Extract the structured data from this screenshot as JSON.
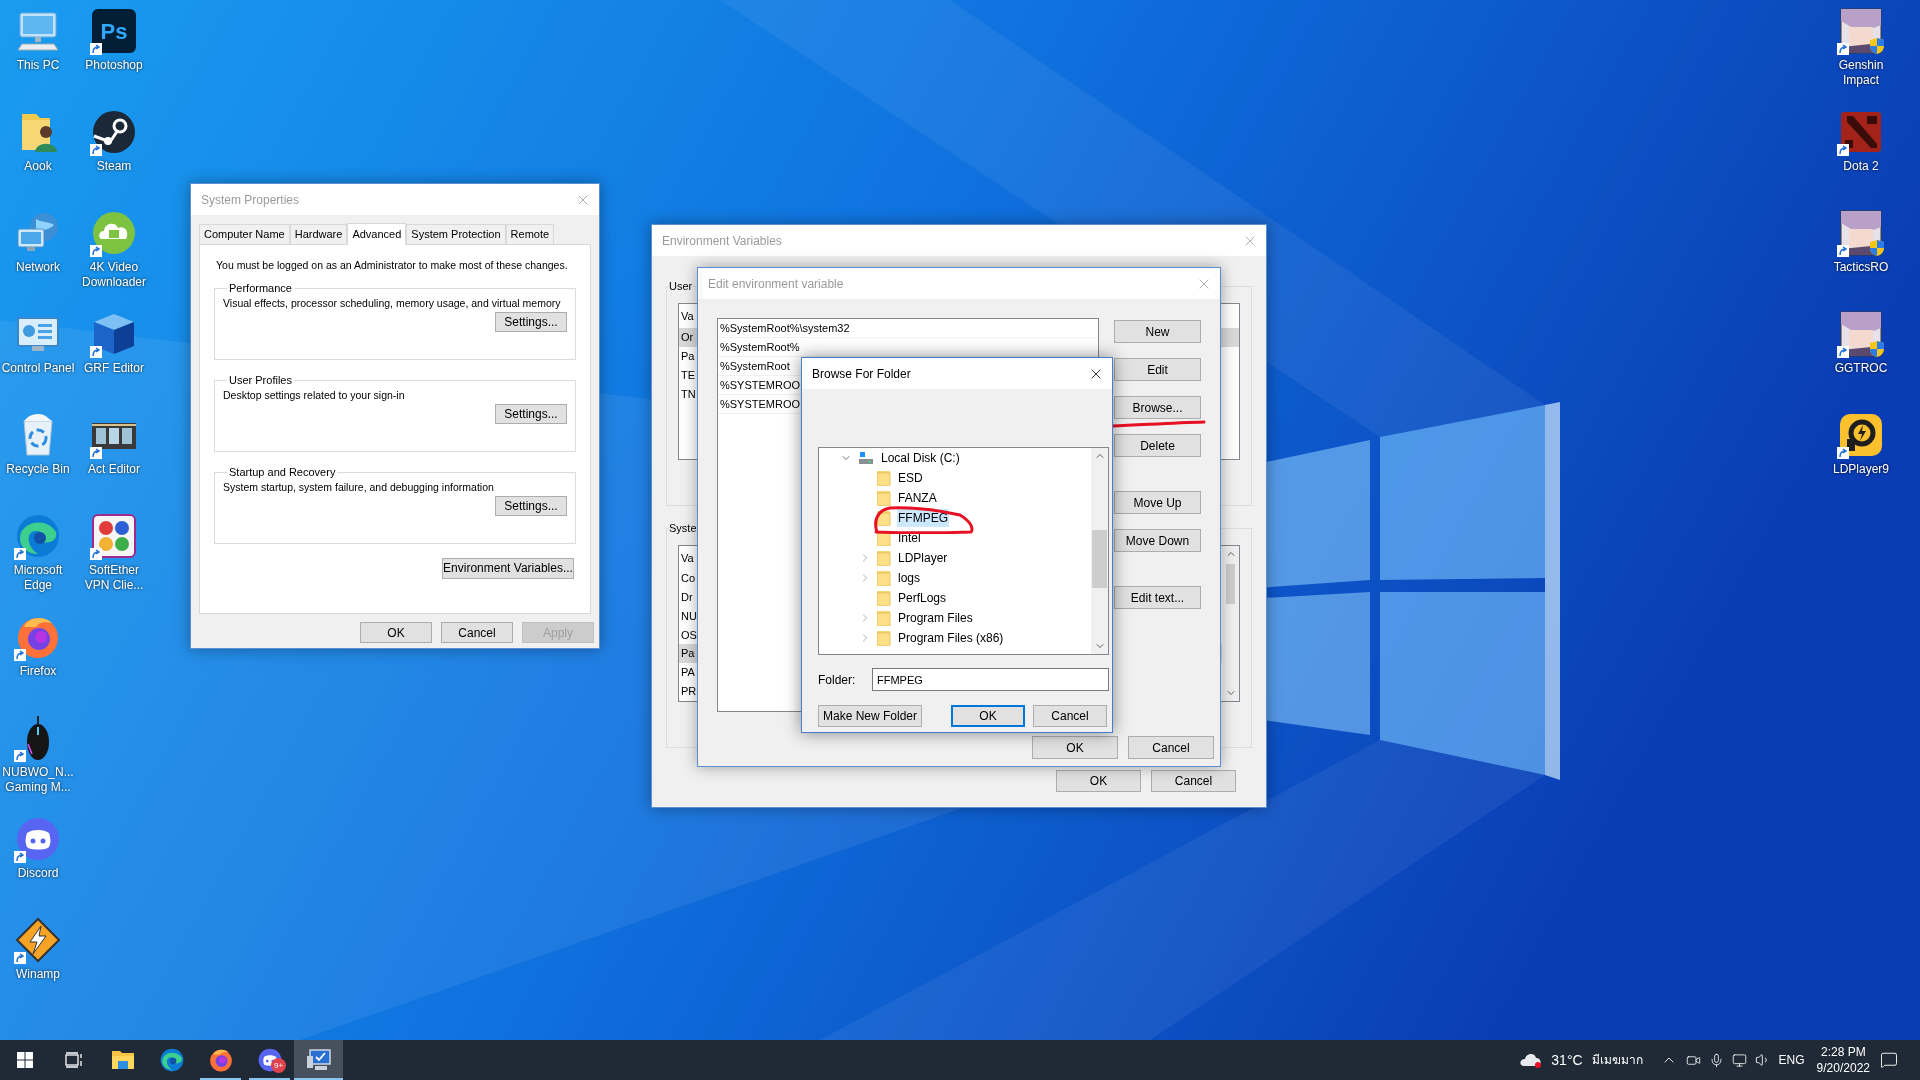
{
  "desktop_icons": {
    "left_column": [
      {
        "kind": "computer",
        "label": [
          "This PC"
        ],
        "shortcut": false,
        "admin": false
      },
      {
        "kind": "user-folder",
        "label": [
          "Aook"
        ],
        "shortcut": false,
        "admin": false
      },
      {
        "kind": "network",
        "label": [
          "Network"
        ],
        "shortcut": false,
        "admin": false
      },
      {
        "kind": "control-panel",
        "label": [
          "Control Panel"
        ],
        "shortcut": false,
        "admin": false
      },
      {
        "kind": "recycle-bin",
        "label": [
          "Recycle Bin"
        ],
        "shortcut": false,
        "admin": false
      },
      {
        "kind": "edge",
        "label": [
          "Microsoft",
          "Edge"
        ],
        "shortcut": true,
        "admin": false
      },
      {
        "kind": "firefox",
        "label": [
          "Firefox"
        ],
        "shortcut": true,
        "admin": false
      },
      {
        "kind": "mouse",
        "label": [
          "NUBWO_N...",
          "Gaming M..."
        ],
        "shortcut": true,
        "admin": false
      },
      {
        "kind": "discord",
        "label": [
          "Discord"
        ],
        "shortcut": true,
        "admin": false
      },
      {
        "kind": "winamp",
        "label": [
          "Winamp"
        ],
        "shortcut": true,
        "admin": false
      }
    ],
    "second_column": [
      {
        "kind": "photoshop",
        "glyph": "Ps",
        "label": [
          "Photoshop"
        ],
        "shortcut": true,
        "admin": false
      },
      {
        "kind": "steam",
        "label": [
          "Steam"
        ],
        "shortcut": true,
        "admin": false
      },
      {
        "kind": "cloud-download",
        "label": [
          "4K Video",
          "Downloader"
        ],
        "shortcut": true,
        "admin": false
      },
      {
        "kind": "cube",
        "label": [
          "GRF Editor"
        ],
        "shortcut": true,
        "admin": false
      },
      {
        "kind": "film",
        "label": [
          "Act Editor"
        ],
        "shortcut": true,
        "admin": false
      },
      {
        "kind": "grid",
        "label": [
          "SoftEther",
          "VPN Clie..."
        ],
        "shortcut": true,
        "admin": false
      }
    ],
    "right_column": [
      {
        "kind": "portrait",
        "label": [
          "Genshin",
          "Impact"
        ],
        "shortcut": true,
        "admin": true
      },
      {
        "kind": "dota",
        "label": [
          "Dota 2"
        ],
        "shortcut": true,
        "admin": false
      },
      {
        "kind": "portrait",
        "label": [
          "TacticsRO"
        ],
        "shortcut": true,
        "admin": true
      },
      {
        "kind": "portrait",
        "label": [
          "GGTROC"
        ],
        "shortcut": true,
        "admin": true
      },
      {
        "kind": "player",
        "label": [
          "LDPlayer9"
        ],
        "shortcut": true,
        "admin": false
      }
    ]
  },
  "system_properties": {
    "title": "System Properties",
    "active": false,
    "tabs": [
      {
        "label": "Computer Name",
        "selected": false
      },
      {
        "label": "Hardware",
        "selected": false
      },
      {
        "label": "Advanced",
        "selected": true
      },
      {
        "label": "System Protection",
        "selected": false
      },
      {
        "label": "Remote",
        "selected": false
      }
    ],
    "note": "You must be logged on as an Administrator to make most of these changes.",
    "groups": [
      {
        "title": "Performance",
        "description": "Visual effects, processor scheduling, memory usage, and virtual memory",
        "button": "Settings..."
      },
      {
        "title": "User Profiles",
        "description": "Desktop settings related to your sign-in",
        "button": "Settings..."
      },
      {
        "title": "Startup and Recovery",
        "description": "System startup, system failure, and debugging information",
        "button": "Settings..."
      }
    ],
    "env_button": "Environment Variables...",
    "buttons": [
      {
        "label": "OK",
        "disabled": false
      },
      {
        "label": "Cancel",
        "disabled": false
      },
      {
        "label": "Apply",
        "disabled": true
      }
    ]
  },
  "environment_variables": {
    "title": "Environment Variables",
    "active": false,
    "user_group": {
      "label": "User",
      "header": "Va",
      "rows": [
        {
          "text": "Or",
          "selected": true
        },
        {
          "text": "Pa",
          "selected": false
        },
        {
          "text": "TE",
          "selected": false
        },
        {
          "text": "TN",
          "selected": false
        }
      ]
    },
    "system_group": {
      "label": "Syste",
      "header": "Va",
      "rows": [
        {
          "text": "Co",
          "selected": false
        },
        {
          "text": "Dr",
          "selected": false
        },
        {
          "text": "NU",
          "selected": false
        },
        {
          "text": "OS",
          "selected": false
        },
        {
          "text": "Pa",
          "selected": true
        },
        {
          "text": "PA",
          "selected": false
        },
        {
          "text": "PR",
          "selected": false
        }
      ]
    },
    "buttons": [
      "OK",
      "Cancel"
    ]
  },
  "edit_variable": {
    "title": "Edit environment variable",
    "active": false,
    "entries": [
      "%SystemRoot%\\system32",
      "%SystemRoot%",
      "%SystemRoot",
      "%SYSTEMROO",
      "%SYSTEMROO"
    ],
    "side_button_groups": [
      [
        {
          "label": "New",
          "underlined": false
        },
        {
          "label": "Edit",
          "underlined": false
        },
        {
          "label": "Browse...",
          "underlined": true
        },
        {
          "label": "Delete",
          "underlined": false
        }
      ],
      [
        {
          "label": "Move Up",
          "underlined": false
        },
        {
          "label": "Move Down",
          "underlined": false
        }
      ],
      [
        {
          "label": "Edit text...",
          "underlined": false
        }
      ]
    ],
    "buttons": [
      "OK",
      "Cancel"
    ]
  },
  "browse_folder": {
    "title": "Browse For Folder",
    "active": true,
    "tree": [
      {
        "label": "Local Disk (C:)",
        "kind": "drive",
        "has_children": true,
        "expanded": true,
        "selected": false,
        "circled": false,
        "children": [
          {
            "label": "ESD",
            "kind": "folder",
            "has_children": false,
            "selected": false,
            "circled": false
          },
          {
            "label": "FANZA",
            "kind": "folder",
            "has_children": false,
            "selected": false,
            "circled": false
          },
          {
            "label": "FFMPEG",
            "kind": "folder",
            "has_children": false,
            "selected": true,
            "circled": true
          },
          {
            "label": "Intel",
            "kind": "folder",
            "has_children": false,
            "selected": false,
            "circled": false
          },
          {
            "label": "LDPlayer",
            "kind": "folder",
            "has_children": true,
            "expanded": false,
            "selected": false,
            "circled": false
          },
          {
            "label": "logs",
            "kind": "folder",
            "has_children": true,
            "expanded": false,
            "selected": false,
            "circled": false
          },
          {
            "label": "PerfLogs",
            "kind": "folder",
            "has_children": false,
            "selected": false,
            "circled": false
          },
          {
            "label": "Program Files",
            "kind": "folder",
            "has_children": true,
            "expanded": false,
            "selected": false,
            "circled": false
          },
          {
            "label": "Program Files (x86)",
            "kind": "folder",
            "has_children": true,
            "expanded": false,
            "selected": false,
            "circled": false
          }
        ]
      }
    ],
    "folder_label": "Folder:",
    "folder_value": "FFMPEG",
    "buttons": [
      {
        "label": "Make New Folder",
        "default": false
      },
      {
        "label": "OK",
        "default": true
      },
      {
        "label": "Cancel",
        "default": false
      }
    ]
  },
  "taskbar": {
    "apps": [
      {
        "kind": "start",
        "running": false,
        "selected": false
      },
      {
        "kind": "task-view",
        "running": false,
        "selected": false
      },
      {
        "kind": "explorer",
        "running": false,
        "selected": false
      },
      {
        "kind": "edge",
        "running": false,
        "selected": false
      },
      {
        "kind": "firefox",
        "running": true,
        "selected": false
      },
      {
        "kind": "discord",
        "running": true,
        "selected": false,
        "badge": "9+"
      },
      {
        "kind": "system",
        "running": true,
        "selected": true
      }
    ],
    "temperature": "31°C",
    "condition": "มีเมฆมาก",
    "language": "ENG",
    "time": "2:28 PM",
    "date": "9/20/2022"
  }
}
